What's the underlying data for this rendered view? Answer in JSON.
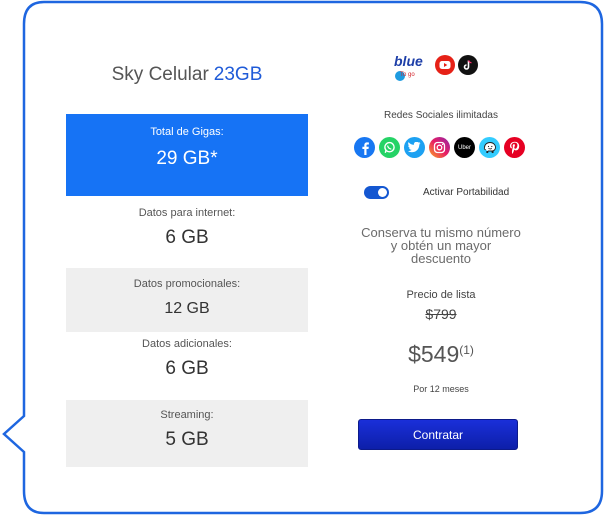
{
  "plan": {
    "name": "Sky Celular",
    "gb": "23GB"
  },
  "boxes": {
    "total": {
      "label": "Total de Gigas:",
      "value": "29 GB*"
    },
    "internet": {
      "label": "Datos para internet:",
      "value": "6 GB"
    },
    "promo": {
      "label": "Datos promocionales:",
      "value": "12 GB"
    },
    "adicional": {
      "label": "Datos adicionales:",
      "value": "6 GB"
    },
    "streaming": {
      "label": "Streaming:",
      "value": "5 GB"
    }
  },
  "brands": {
    "blue_text": "blue",
    "blue_sub": "To go"
  },
  "social": {
    "title": "Redes Sociales ilimitadas",
    "icons": [
      "facebook-icon",
      "whatsapp-icon",
      "twitter-icon",
      "instagram-icon",
      "uber-icon",
      "waze-icon",
      "pinterest-icon"
    ],
    "uber_text": "Uber"
  },
  "portabilidad": {
    "label": "Activar Portabilidad",
    "enabled": true
  },
  "promo": {
    "line1": "Conserva tu mismo número",
    "line2": "y obtén un mayor",
    "line3": "descuento"
  },
  "pricing": {
    "list_label": "Precio de lista",
    "list_price": "$799",
    "price": "$549",
    "note": "(1)",
    "period": "Por 12 meses"
  },
  "cta": {
    "label": "Contratar"
  },
  "colors": {
    "accent": "#1673f5",
    "title_gb": "#1f5bd8",
    "border": "#1e66e0",
    "button": "#1a2fd9"
  }
}
